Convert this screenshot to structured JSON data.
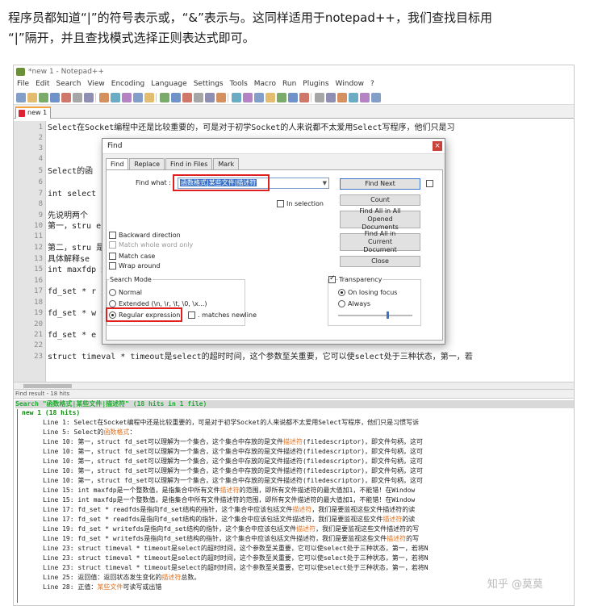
{
  "intro": {
    "line1": "程序员都知道“|”的符号表示或，“&”表示与。这同样适用于notepad++，我们查找目标用",
    "line2": "“|”隔开，并且查找模式选择正则表达式即可。"
  },
  "window": {
    "title": "*new 1 - Notepad++",
    "menu": [
      "File",
      "Edit",
      "Search",
      "View",
      "Encoding",
      "Language",
      "Settings",
      "Tools",
      "Macro",
      "Run",
      "Plugins",
      "Window",
      "?"
    ],
    "tab": "new 1"
  },
  "editor": {
    "lines": [
      {
        "n": "1",
        "text": " Select在Socket编程中还是比较重要的，可是对于初学Socket的人来说都不太爱用Select写程序，他们只是习"
      },
      {
        "n": "2",
        "text": ""
      },
      {
        "n": "3",
        "text": ""
      },
      {
        "n": "4",
        "text": ""
      },
      {
        "n": "5",
        "text": "Select的函"
      },
      {
        "n": "6",
        "text": ""
      },
      {
        "n": "7",
        "text": "int select                                                                   ruct timeval*timeout);"
      },
      {
        "n": "8",
        "text": ""
      },
      {
        "n": "9",
        "text": "先说明两个"
      },
      {
        "n": "10",
        "text": "第一，stru                                                                    escriptor), 即文件句柄，"
      },
      {
        "n": "11",
        "text": ""
      },
      {
        "n": "12",
        "text": "第二，stru                                                                    是秒数，另一个是毫秒数。"
      },
      {
        "n": "13",
        "text": "具体解释se"
      },
      {
        "n": "15",
        "text": "int maxfdp                                                                    最大值加1，不能错！在wi"
      },
      {
        "n": "16",
        "text": ""
      },
      {
        "n": "17",
        "text": "fd_set * r                                                                    是要监视这些文件描述符的"
      },
      {
        "n": "18",
        "text": ""
      },
      {
        "n": "19",
        "text": "fd_set * w                                                                    们是要监视这些文件描述符"
      },
      {
        "n": "20",
        "text": ""
      },
      {
        "n": "21",
        "text": "fd_set * e"
      },
      {
        "n": "22",
        "text": ""
      },
      {
        "n": "23",
        "text": "struct timeval * timeout是select的超时时间，这个参数至关重要，它可以使select处于三种状态，第一，若"
      }
    ]
  },
  "find_dialog": {
    "title": "Find",
    "close": "×",
    "tabs": [
      "Find",
      "Replace",
      "Find in Files",
      "Mark"
    ],
    "find_what_label": "Find what :",
    "find_what_value": "函数格式|某些文件|描述符",
    "in_selection": "In selection",
    "buttons": {
      "find_next": "Find Next",
      "count": "Count",
      "find_all_opened": "Find All in All Opened Documents",
      "find_all_current": "Find All in Current Document",
      "close": "Close"
    },
    "options": {
      "backward": "Backward direction",
      "whole_word": "Match whole word only",
      "match_case": "Match case",
      "wrap_around": "Wrap around"
    },
    "search_mode": {
      "label": "Search Mode",
      "normal": "Normal",
      "extended": "Extended (\\n, \\r, \\t, \\0, \\x...)",
      "regex": "Regular expression",
      "matches_newline": ". matches newline"
    },
    "transparency": {
      "label": "Transparency",
      "on_losing_focus": "On losing focus",
      "always": "Always"
    }
  },
  "results": {
    "panel_title": "Find result - 18 hits",
    "search_line": "Search \"函数格式|某些文件|描述符\" (18 hits in 1 file)",
    "file_line": "new 1 (18 hits)",
    "hits": [
      {
        "pre": "Line 1:  Select在Socket编程中还是比较重要的，可是对于初学Socket的人来说都不太爱用Select写程序，他们只是习惯写诉",
        "hl": "",
        "post": ""
      },
      {
        "pre": "Line 5: Select的",
        "hl": "函数格式",
        "post": "："
      },
      {
        "pre": "Line 10: 第一，struct fd_set可以理解为一个集合，这个集合中存放的是文件",
        "hl": "描述符",
        "post": "(filedescriptor)，即文件句柄，这可"
      },
      {
        "pre": "Line 10: 第一，struct fd_set可以理解为一个集合，这个集合中存放的是文件描述符(filedescriptor)，即文件句柄，这可",
        "hl": "",
        "post": ""
      },
      {
        "pre": "Line 10: 第一，struct fd_set可以理解为一个集合，这个集合中存放的是文件描述符(filedescriptor)，即文件句柄，这可",
        "hl": "",
        "post": ""
      },
      {
        "pre": "Line 10: 第一，struct fd_set可以理解为一个集合，这个集合中存放的是文件描述符(filedescriptor)，即文件句柄，这可",
        "hl": "",
        "post": ""
      },
      {
        "pre": "Line 10: 第一，struct fd_set可以理解为一个集合，这个集合中存放的是文件描述符(filedescriptor)，即文件句柄，这可",
        "hl": "",
        "post": ""
      },
      {
        "pre": "Line 15: int maxfdp是一个整数值，是指集合中所有文件",
        "hl": "描述符",
        "post": "的范围，即所有文件描述符的最大值加1，不能错！在Window"
      },
      {
        "pre": "Line 15: int maxfdp是一个整数值，是指集合中所有文件描述符的范围，即所有文件描述符的最大值加1，不能错！在Window",
        "hl": "",
        "post": ""
      },
      {
        "pre": "Line 17: fd_set * readfds是指向fd_set结构的指针，这个集合中应该包括文件",
        "hl": "描述符",
        "post": "，我们是要监视这些文件描述符的读"
      },
      {
        "pre": "Line 17: fd_set * readfds是指向fd_set结构的指针，这个集合中应该包括文件描述符，我们是要监视这些文件",
        "hl": "描述符",
        "post": "的读"
      },
      {
        "pre": "Line 19: fd_set * writefds是指向fd_set结构的指针，这个集合中应该包括文件",
        "hl": "描述符",
        "post": "，我们是要监视这些文件描述符的写"
      },
      {
        "pre": "Line 19: fd_set * writefds是指向fd_set结构的指针，这个集合中应该包括文件描述符，我们是要监视这些文件",
        "hl": "描述符",
        "post": "的写"
      },
      {
        "pre": "Line 23: struct timeval * timeout是select的超时时间，这个参数至关重要，它可以使select处于三种状态，第一，若将N",
        "hl": "",
        "post": ""
      },
      {
        "pre": "Line 23: struct timeval * timeout是select的超时时间，这个参数至关重要，它可以使select处于三种状态，第一，若将N",
        "hl": "",
        "post": ""
      },
      {
        "pre": "Line 23: struct timeval * timeout是select的超时时间，这个参数至关重要，它可以使select处于三种状态，第一，若将N",
        "hl": "",
        "post": ""
      },
      {
        "pre": "Line 25: 返回值：返回状态发生变化的",
        "hl": "描述符",
        "post": "总数。"
      },
      {
        "pre": "Line 28: 正值：",
        "hl": "某些文件",
        "post": "可读写或出错"
      }
    ]
  },
  "watermark": "知乎 @莫莫",
  "toolbar_icons": [
    "new-icon",
    "open-icon",
    "save-icon",
    "save-all-icon",
    "close-icon",
    "close-all-icon",
    "print-icon",
    "cut-icon",
    "copy-icon",
    "paste-icon",
    "undo-icon",
    "redo-icon",
    "find-icon",
    "replace-icon",
    "zoom-in-icon",
    "zoom-out-icon",
    "sync-v-icon",
    "sync-h-icon",
    "wrap-icon",
    "all-chars-icon",
    "indent-guide-icon",
    "udl-icon",
    "doc-map-icon",
    "function-list-icon",
    "folder-icon",
    "monitor-icon",
    "record-icon",
    "stop-icon",
    "play-icon",
    "play-multi-icon",
    "save-macro-icon"
  ],
  "colors": {
    "accent": "#3a73c8",
    "highlight_box": "#e02020",
    "result_hit": "#e07020",
    "tab_accent": "#f6a23c"
  }
}
